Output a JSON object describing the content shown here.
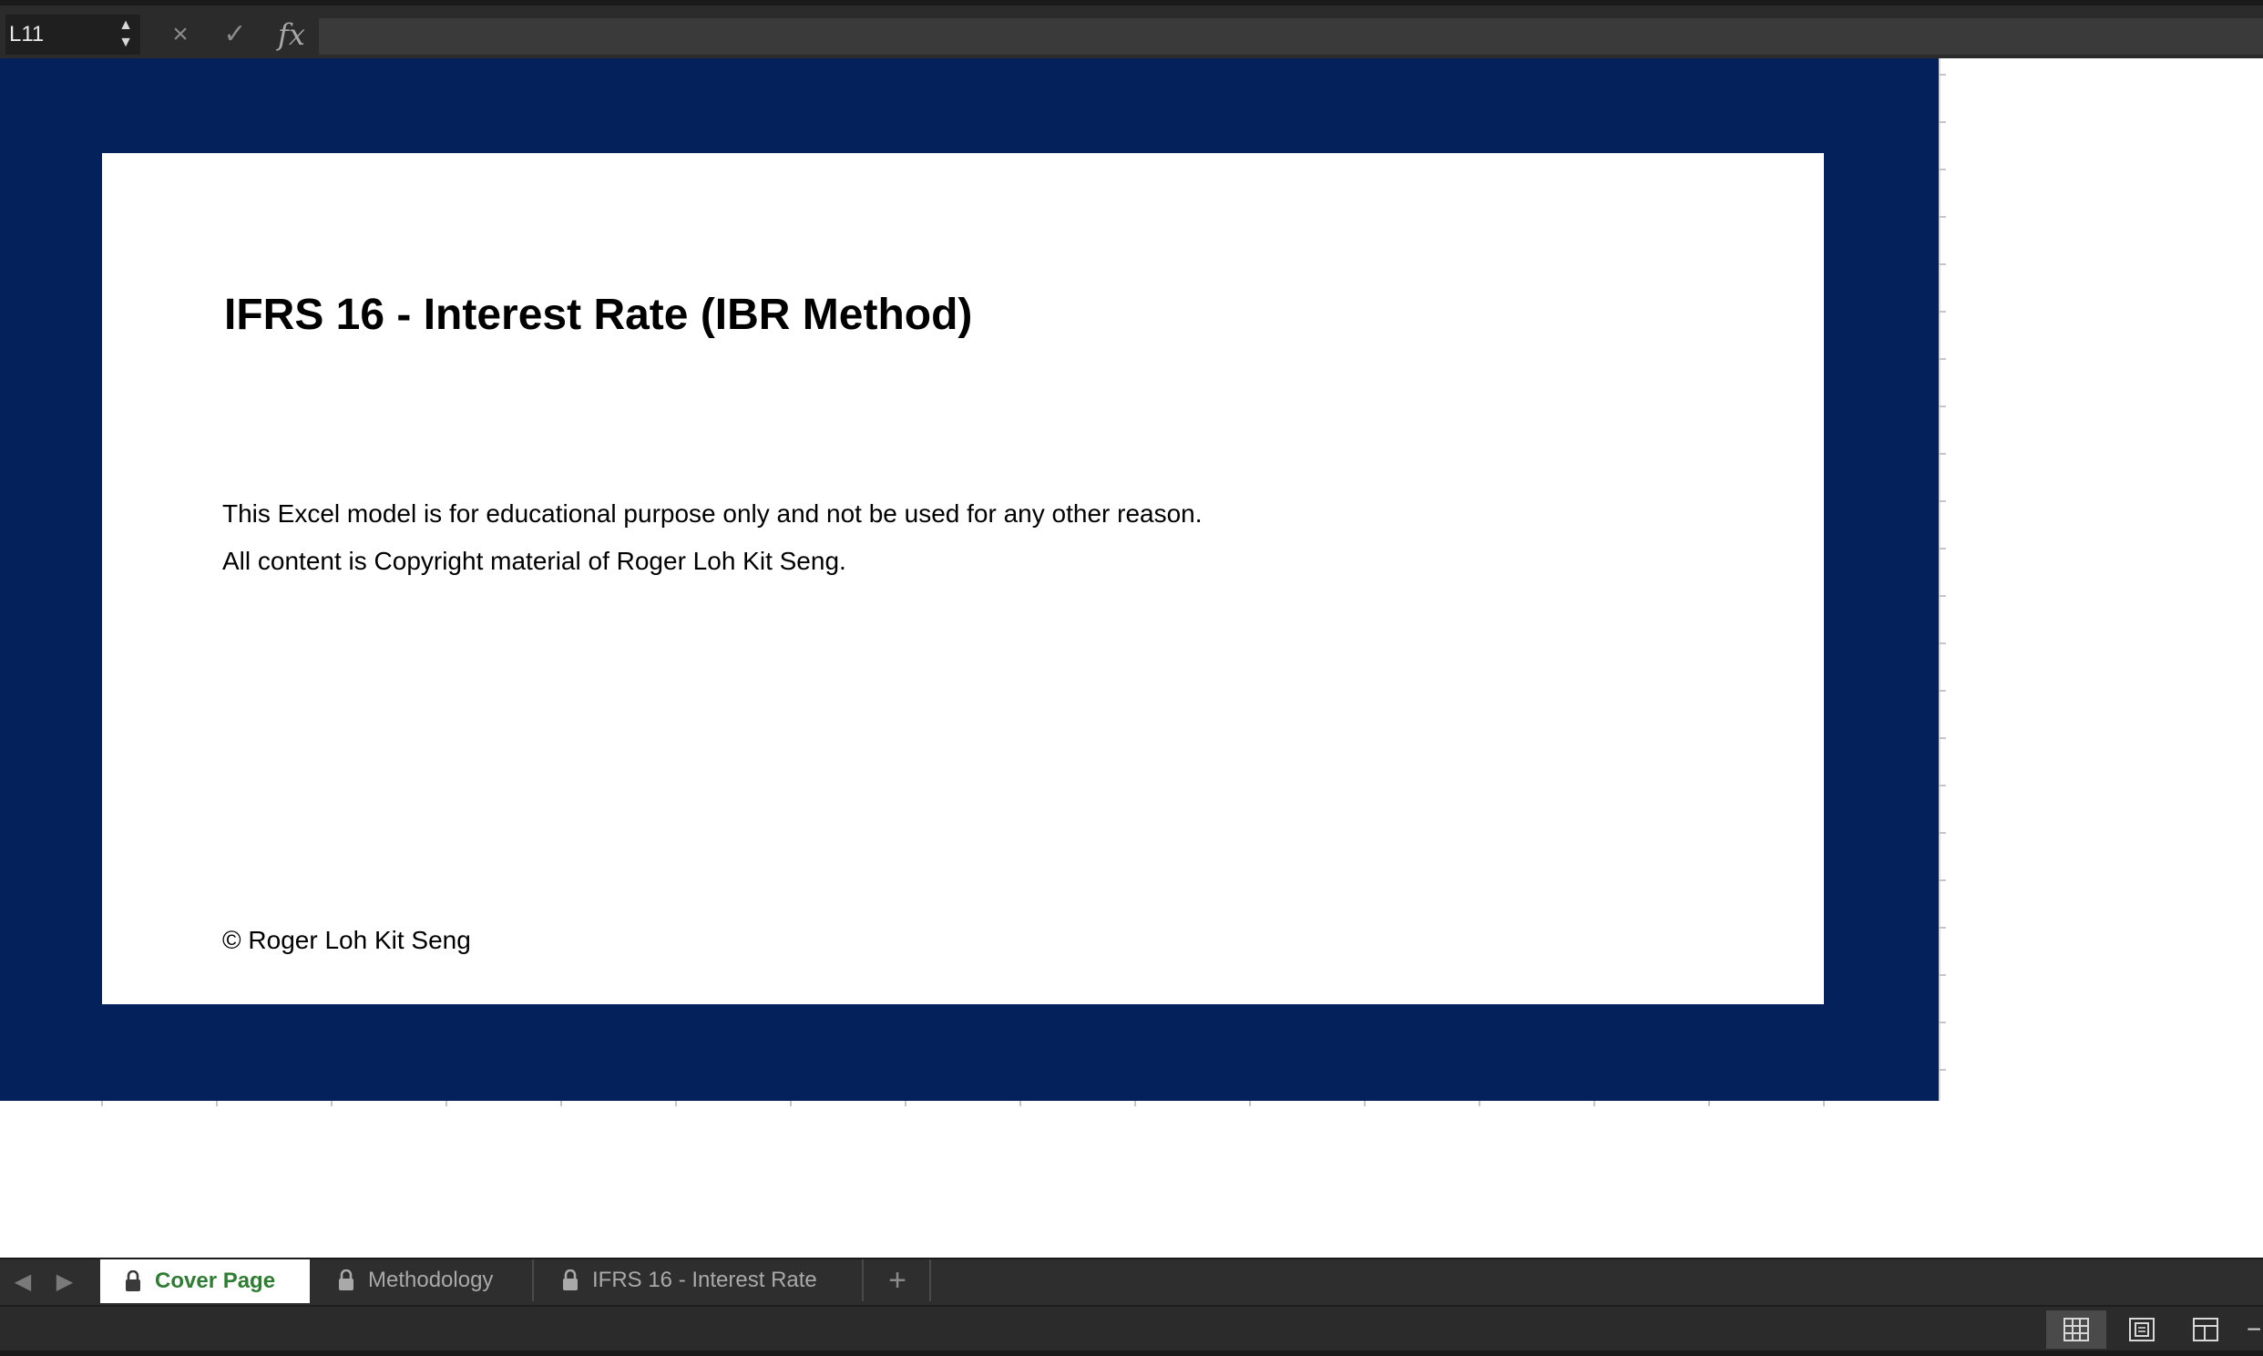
{
  "formula_bar": {
    "cell_reference": "L11",
    "formula_value": "",
    "cancel_icon": "×",
    "confirm_icon": "✓",
    "fx_label": "fx"
  },
  "document": {
    "title": "IFRS 16 - Interest Rate (IBR Method)",
    "disclaimer_line1": "This Excel model is for educational purpose only and not be used for any other reason.",
    "disclaimer_line2": "All content is Copyright material of Roger Loh Kit Seng.",
    "copyright": "© Roger Loh Kit Seng"
  },
  "colors": {
    "band": "#05215c",
    "active_tab_text": "#2e7d32"
  },
  "sheet_tabs": [
    {
      "label": "Cover Page",
      "active": true,
      "locked": true
    },
    {
      "label": "Methodology",
      "active": false,
      "locked": true
    },
    {
      "label": "IFRS 16 - Interest Rate",
      "active": false,
      "locked": true
    }
  ],
  "tab_controls": {
    "add_sheet_label": "+"
  },
  "view_modes": [
    "normal-view-icon",
    "page-layout-view-icon",
    "page-break-view-icon"
  ],
  "status_bar": {
    "zoom_out_label": "−"
  }
}
